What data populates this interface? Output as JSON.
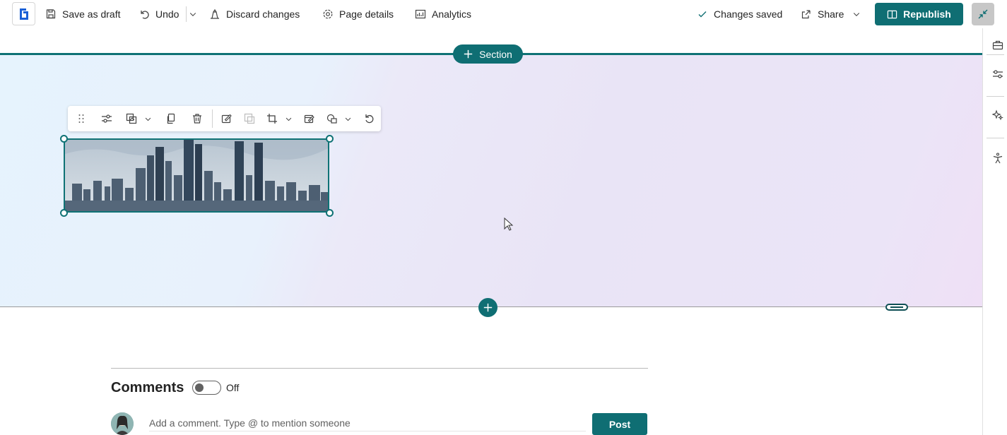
{
  "topbar": {
    "save_draft": "Save as draft",
    "undo": "Undo",
    "discard": "Discard changes",
    "page_details": "Page details",
    "analytics": "Analytics",
    "status": "Changes saved",
    "share": "Share",
    "republish": "Republish"
  },
  "canvas": {
    "section_button": "Section"
  },
  "comments": {
    "title": "Comments",
    "toggle_state": "Off",
    "placeholder": "Add a comment. Type @ to mention someone",
    "post": "Post"
  },
  "colors": {
    "accent": "#0f6e73",
    "section_border": "#0f7275"
  },
  "icons": {
    "top": [
      "app-logo-icon",
      "save-icon",
      "undo-icon",
      "chevron-down-icon",
      "discard-icon",
      "gear-icon",
      "analytics-icon",
      "checkmark-icon",
      "share-icon",
      "book-open-icon",
      "collapse-icon"
    ],
    "toolbar": [
      "drag-handle-icon",
      "settings-sliders-icon",
      "image-style-icon",
      "copy-icon",
      "delete-icon",
      "edit-image-icon",
      "image-alt-icon",
      "crop-icon",
      "image-note-icon",
      "shapes-icon",
      "reset-icon"
    ],
    "rail": [
      "toolbox-icon",
      "properties-icon",
      "sparkle-icon",
      "accessibility-icon"
    ]
  }
}
